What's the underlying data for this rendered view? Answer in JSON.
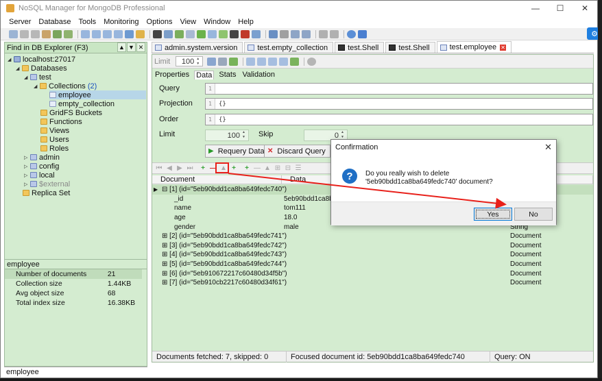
{
  "window": {
    "title": "NoSQL Manager for MongoDB Professional"
  },
  "menu": [
    "Server",
    "Database",
    "Tools",
    "Monitoring",
    "Options",
    "View",
    "Window",
    "Help"
  ],
  "explorer": {
    "find_label": "Find in DB Explorer (F3)",
    "server": "localhost:27017",
    "databases_label": "Databases",
    "db_test": "test",
    "collections_label": "Collections",
    "collections_count": "(2)",
    "collection_1": "employee",
    "collection_2": "empty_collection",
    "gridfs": "GridFS Buckets",
    "functions": "Functions",
    "views": "Views",
    "users": "Users",
    "roles": "Roles",
    "db_admin": "admin",
    "db_config": "config",
    "db_local": "local",
    "db_external": "$external",
    "replica": "Replica Set"
  },
  "props": {
    "header": "employee",
    "rows": [
      {
        "k": "Number of documents",
        "v": "21"
      },
      {
        "k": "Collection size",
        "v": "1.44KB"
      },
      {
        "k": "Avg object size",
        "v": "68"
      },
      {
        "k": "Total index size",
        "v": "16.38KB"
      }
    ]
  },
  "status_left": "employee",
  "tabs": [
    "admin.system.version",
    "test.empty_collection",
    "test.Shell",
    "test.Shell",
    "test.employee"
  ],
  "limitbar": {
    "label": "Limit",
    "value": "100"
  },
  "subtabs": [
    "Properties",
    "Data",
    "Stats",
    "Validation"
  ],
  "query": {
    "query_label": "Query",
    "projection_label": "Projection",
    "order_label": "Order",
    "limit_label": "Limit",
    "skip_label": "Skip",
    "line": "1",
    "projection_value": "{}",
    "order_value": "{}",
    "limit_value": "100",
    "skip_value": "0",
    "requery": "Requery Data",
    "discard": "Discard Query"
  },
  "grid": {
    "headers": [
      "Document",
      "Data",
      "Type"
    ],
    "rows": [
      {
        "doc": "[1] (id=\"5eb90bdd1ca8ba649fedc740\")",
        "data": "",
        "type": ""
      },
      {
        "doc": "_id",
        "data": "5eb90bdd1ca8ba",
        "type": ""
      },
      {
        "doc": "name",
        "data": "tom111",
        "type": ""
      },
      {
        "doc": "age",
        "data": "18.0",
        "type": ""
      },
      {
        "doc": "gender",
        "data": "male",
        "type": "String"
      },
      {
        "doc": "[2] (id=\"5eb90bdd1ca8ba649fedc741\")",
        "data": "",
        "type": "Document"
      },
      {
        "doc": "[3] (id=\"5eb90bdd1ca8ba649fedc742\")",
        "data": "",
        "type": "Document"
      },
      {
        "doc": "[4] (id=\"5eb90bdd1ca8ba649fedc743\")",
        "data": "",
        "type": "Document"
      },
      {
        "doc": "[5] (id=\"5eb90bdd1ca8ba649fedc744\")",
        "data": "",
        "type": "Document"
      },
      {
        "doc": "[6] (id=\"5eb910672217c60480d34f5b\")",
        "data": "",
        "type": "Document"
      },
      {
        "doc": "[7] (id=\"5eb910cb2217c60480d34f61\")",
        "data": "",
        "type": "Document"
      }
    ]
  },
  "status": {
    "fetched": "Documents fetched: 7, skipped: 0",
    "focused": "Focused document id: 5eb90bdd1ca8ba649fedc740",
    "query": "Query: ON"
  },
  "dialog": {
    "title": "Confirmation",
    "message": "Do you really wish to delete '5eb90bdd1ca8ba649fedc740' document?",
    "yes": "Yes",
    "no": "No"
  },
  "colors": {
    "panel_green": "#d4ecd0",
    "annotation_red": "#e8201a",
    "accent_blue": "#1f6fc5"
  }
}
